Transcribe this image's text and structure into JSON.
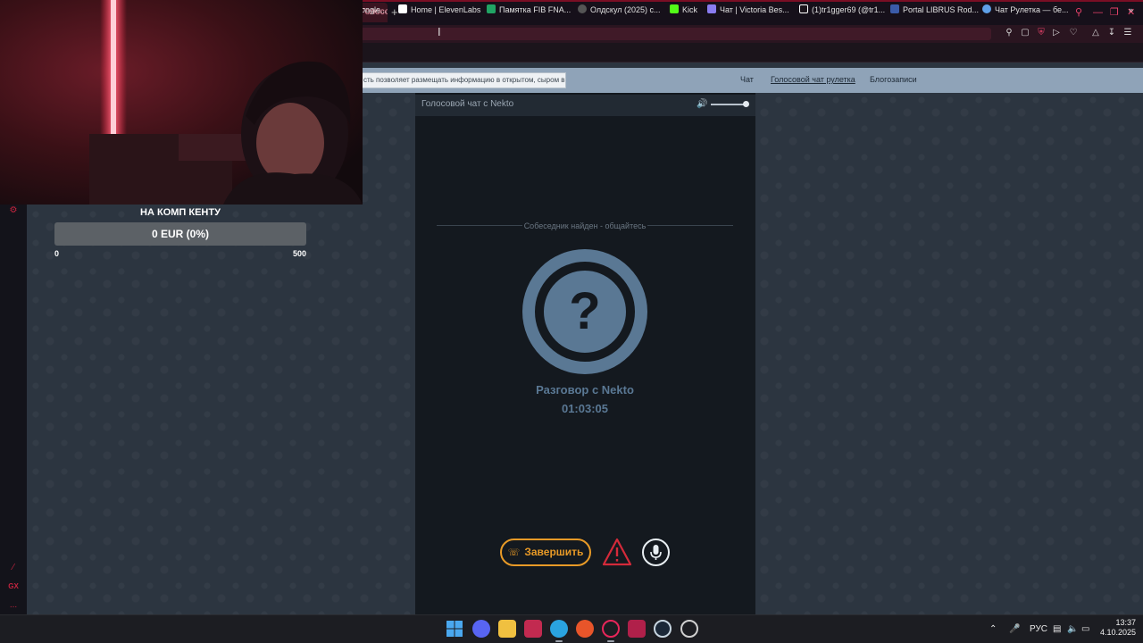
{
  "browser": {
    "active_tab_label": "Голосов",
    "new_tab_symbol": "+",
    "bookmarks": [
      {
        "label": "oogle...",
        "icon": "google-icon",
        "color": "#4a8af4"
      },
      {
        "label": "Home | ElevenLabs",
        "icon": "elevenlabs-icon",
        "color": "#ffffff"
      },
      {
        "label": "Памятка FIB FNA...",
        "icon": "sheets-icon",
        "color": "#21a464"
      },
      {
        "label": "Олдскул (2025) с...",
        "icon": "film-icon",
        "color": "#aaaaaa"
      },
      {
        "label": "Kick",
        "icon": "kick-icon",
        "color": "#53fc18"
      },
      {
        "label": "Чат | Victoria Bes...",
        "icon": "chat-icon",
        "color": "#8a7cf0"
      },
      {
        "label": "(1)tr1gger69 (@tr1...",
        "icon": "tiktok-icon",
        "color": "#ffffff"
      },
      {
        "label": "Portal LIBRUS Rod...",
        "icon": "librus-icon",
        "color": "#3b5ba8"
      },
      {
        "label": "Чат Рулетка — бе...",
        "icon": "roulette-icon",
        "color": "#5fa0e8"
      }
    ]
  },
  "site": {
    "notice": "сть позволяет размещать информацию в открытом, сыром виде!",
    "nav": [
      {
        "label": "Чат",
        "active": false
      },
      {
        "label": "Голосовой чат рулетка",
        "active": true
      },
      {
        "label": "Блогозаписи",
        "active": false
      }
    ],
    "panel_title": "Голосовой чат с Nekto",
    "found_text": "Собеседник найден - общайтесь",
    "avatar_symbol": "?",
    "conversation_title": "Разговор с Nekto",
    "timer": "01:03:05",
    "end_button": "Завершить"
  },
  "donation_goal": {
    "title": "НА КОМП КЕНТУ",
    "value_text": "0 EUR (0%)",
    "progress_fraction": 0,
    "min": "0",
    "max": "500"
  },
  "gx_sidebar": {
    "label": "GX",
    "more": "..."
  },
  "taskbar": {
    "language": "РУС",
    "time": "13:37",
    "date": "4.10.2025"
  },
  "colors": {
    "accent": "#e8426a",
    "end_button": "#e89a27",
    "avatar": "#5a7894",
    "warning": "#d42a3a"
  }
}
